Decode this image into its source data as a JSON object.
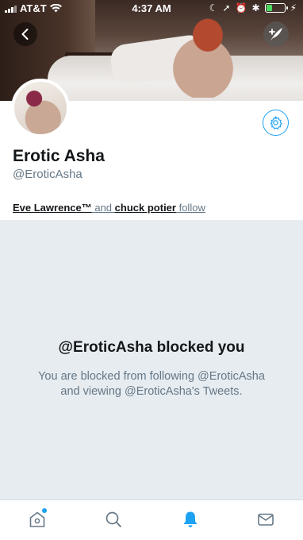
{
  "status_bar": {
    "carrier": "AT&T",
    "time": "4:37 AM",
    "battery_level": 0.35
  },
  "profile": {
    "name": "Erotic Asha",
    "handle": "@EroticAsha",
    "followers_known": {
      "first": "Eve Lawrence™",
      "connector": "and",
      "second": "chuck potier",
      "suffix": "follow"
    }
  },
  "blocked": {
    "title": "@EroticAsha blocked you",
    "body": "You are blocked from following @EroticAsha and viewing @EroticAsha's Tweets."
  },
  "colors": {
    "accent": "#1da1f2",
    "blocked_bg": "#e6ecf0",
    "secondary_text": "#657786"
  },
  "icons": {
    "back": "chevron-left-icon",
    "compose": "compose-tweet-icon",
    "settings": "gear-icon",
    "tabs": [
      "home-icon",
      "search-icon",
      "notifications-bell-icon",
      "messages-envelope-icon"
    ]
  }
}
